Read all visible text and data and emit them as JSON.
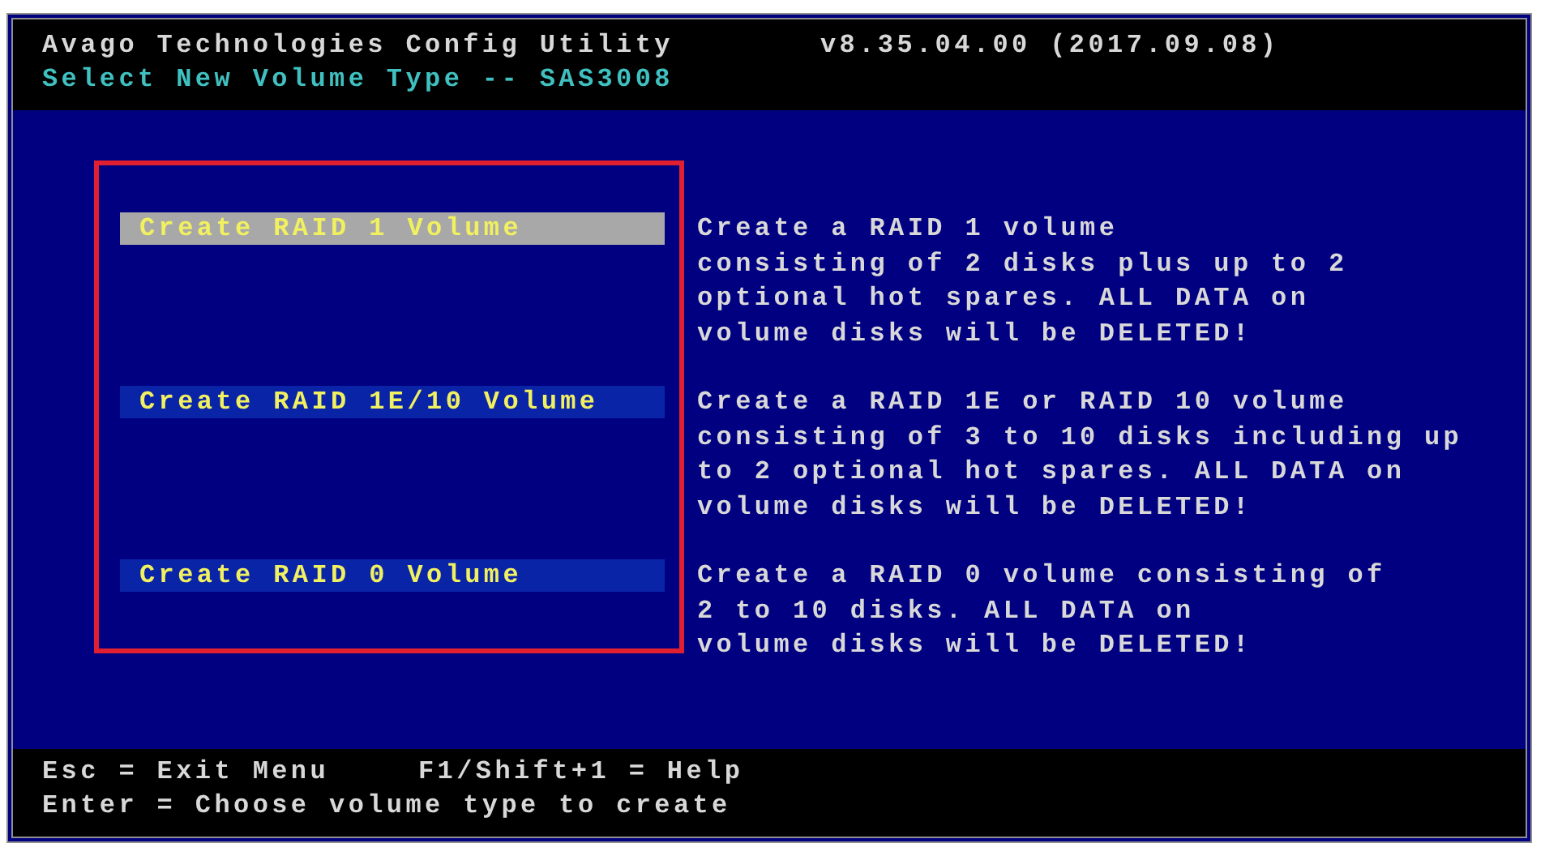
{
  "header": {
    "title": "Avago Technologies Config Utility",
    "version": "v8.35.04.00 (2017.09.08)",
    "subtitle": "Select New Volume Type -- SAS3008"
  },
  "menu": [
    {
      "label": "Create RAID 1 Volume",
      "selected": true,
      "description": "Create a RAID 1 volume\nconsisting of 2 disks plus up to 2\noptional hot spares. ALL DATA on\nvolume disks will be DELETED!"
    },
    {
      "label": "Create RAID 1E/10 Volume",
      "selected": false,
      "description": "Create a RAID 1E or RAID 10 volume\nconsisting of 3 to 10 disks including up\nto 2 optional hot spares. ALL DATA on\nvolume disks will be DELETED!"
    },
    {
      "label": "Create RAID 0 Volume",
      "selected": false,
      "description": "Create a RAID 0 volume consisting of\n2 to 10 disks. ALL DATA on\nvolume disks will be DELETED!"
    }
  ],
  "footer": {
    "hints": [
      "Esc = Exit Menu",
      "F1/Shift+1 = Help",
      "Enter = Choose volume type to create"
    ]
  }
}
